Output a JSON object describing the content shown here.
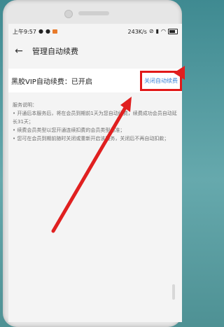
{
  "status": {
    "time": "上午9:57",
    "network_speed": "243K/s"
  },
  "header": {
    "back_icon": "back-arrow-icon",
    "title": "管理自动续费"
  },
  "subscription": {
    "label": "黑胶VIP自动续费：已开启",
    "close_label": "关闭自动续费"
  },
  "info": {
    "heading": "服务说明：",
    "lines": [
      "• 开通后本服务后，将在会员到期前1天为您自动续费，续费成功会员自动延长31天；",
      "• 续费会员类型以您开通连续扣费的会员类型为准；",
      "• 您可在会员到期前随时关闭或重新开启该服务，关闭后不再自动扣款；"
    ]
  },
  "colors": {
    "accent_link": "#3d84d8",
    "highlight_box": "#e11919",
    "annotation_arrow": "#e02020"
  }
}
